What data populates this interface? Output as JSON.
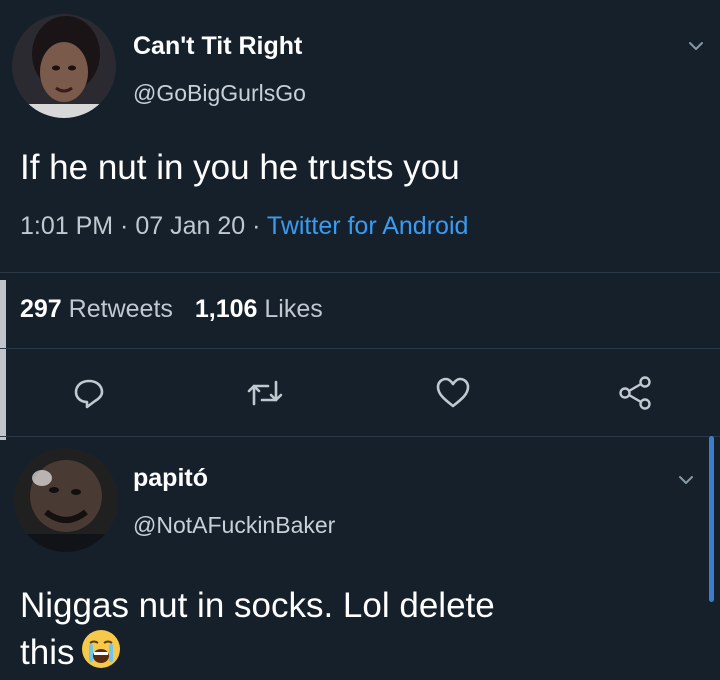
{
  "tweet": {
    "author_name": "Can't Tit Right",
    "author_handle": "@GoBigGurlsGo",
    "text": "If he nut in you he trusts you",
    "time": "1:01 PM",
    "sep1": " · ",
    "date": "07 Jan 20",
    "sep2": " · ",
    "source": "Twitter for Android",
    "retweets_count": "297",
    "retweets_label": "Retweets",
    "likes_count": "1,106",
    "likes_label": "Likes"
  },
  "actions": {
    "reply_icon": "reply-icon",
    "retweet_icon": "retweet-icon",
    "like_icon": "heart-icon",
    "share_icon": "share-icon"
  },
  "reply": {
    "author_name": "papitó",
    "author_handle": "@NotAFuckinBaker",
    "text_line1": "Niggas nut in socks. Lol delete",
    "text_line2": "this",
    "emoji": "crying-face-emoji"
  },
  "colors": {
    "background": "#15202b",
    "link": "#3a9bf2",
    "secondary_text": "#c0c8d0"
  }
}
